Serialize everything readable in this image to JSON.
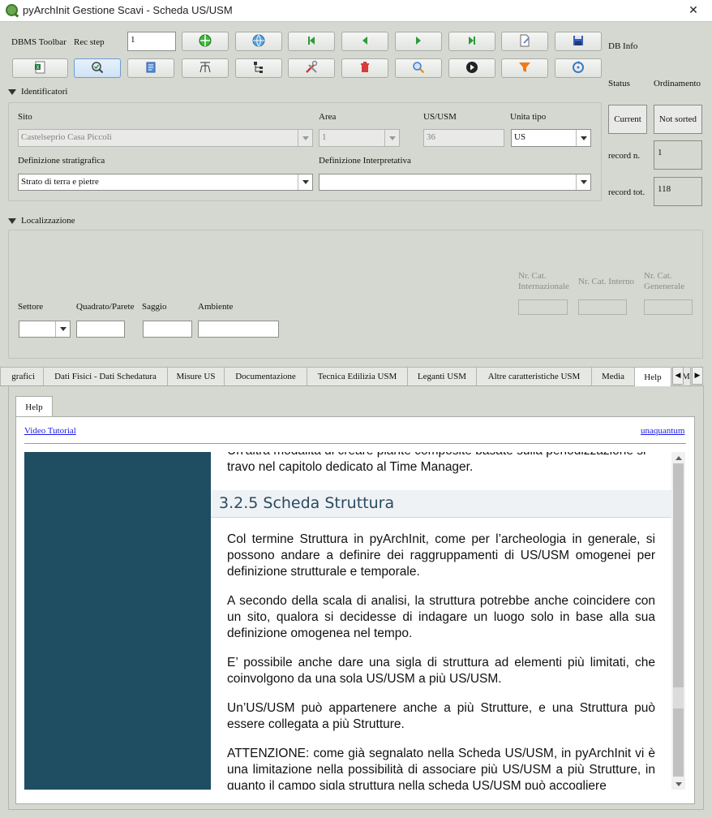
{
  "window": {
    "title": "pyArchInit Gestione Scavi - Scheda US/USM",
    "close": "✕"
  },
  "toolbar": {
    "dbms_label": "DBMS Toolbar",
    "rec_step_label": "Rec step",
    "rec_step_value": "1",
    "db_info_label": "DB Info",
    "row1_icons": [
      "connect-icon",
      "globe-icon",
      "first-record-icon",
      "prev-record-icon",
      "next-record-icon",
      "last-record-icon",
      "new-record-icon",
      "save-icon"
    ],
    "row2_icons": [
      "export-icon",
      "check-icon",
      "report-icon",
      "matrix-icon",
      "tree-icon",
      "tools-icon",
      "delete-icon",
      "search-icon",
      "play-icon",
      "filter-icon",
      "refresh-icon"
    ]
  },
  "status": {
    "status_label": "Status",
    "ordinamento_label": "Ordinamento",
    "current": "Current",
    "not_sorted": "Not sorted",
    "record_n_label": "record n.",
    "record_n": "1",
    "record_tot_label": "record tot.",
    "record_tot": "118"
  },
  "identificatori": {
    "header": "Identificatori",
    "sito_label": "Sito",
    "sito_value": "Castelseprio Casa Piccoli",
    "area_label": "Area",
    "area_value": "1",
    "us_label": "US/USM",
    "us_value": "36",
    "unita_tipo_label": "Unita tipo",
    "unita_tipo_value": "US",
    "def_strat_label": "Definizione stratigrafica",
    "def_strat_value": "Strato di terra e pietre",
    "def_interp_label": "Definizione Interpretativa",
    "def_interp_value": ""
  },
  "localizzazione": {
    "header": "Localizzazione",
    "settore_label": "Settore",
    "quadrato_label": "Quadrato/Parete",
    "saggio_label": "Saggio",
    "ambiente_label": "Ambiente",
    "nr_cat_int_label1": "Nr. Cat.",
    "nr_cat_int_label2": "Internazionale",
    "nr_cat_interno_label": "Nr. Cat. Interno",
    "nr_cat_gen_label1": "Nr. Cat.",
    "nr_cat_gen_label2": "Genenerale"
  },
  "tabs": [
    "grafici",
    "Dati Fisici - Dati Schedatura",
    "Misure US",
    "Documentazione",
    "Tecnica Edilizia USM",
    "Leganti USM",
    "Altre caratteristiche USM",
    "Media",
    "Help",
    "M"
  ],
  "tab_nav": {
    "left": "◀",
    "right": "▶"
  },
  "help": {
    "subtab": "Help",
    "video_tutorial": "Video Tutorial",
    "unaquantum": "unaquantum",
    "doc": {
      "partial_top": "Un'altra modalità di creare piante composite basate sulla periodizzazione si",
      "line2": "travo nel capitolo dedicato al Time Manager.",
      "heading": "3.2.5 Scheda Struttura",
      "p1": "Col termine Struttura in pyArchInit, come per l’archeologia in generale, si possono andare a definire dei raggruppamenti di US/USM omogenei per definizione strutturale e temporale.",
      "p2": "A secondo della scala di analisi, la struttura potrebbe anche coincidere con un sito, qualora si decidesse di indagare un luogo solo in base alla sua definizione omogenea nel tempo.",
      "p3": "E’ possibile anche dare una sigla di struttura ad elementi più limitati, che coinvolgono da una sola US/USM a più US/USM.",
      "p4": "Un’US/USM può appartenere anche a più Strutture, e una Struttura può essere collegata a più Strutture.",
      "p5": "ATTENZIONE: come già segnalato nella Scheda US/USM, in pyArchInit vi è una limitazione nella possibilità di associare più US/USM a più Strutture, in quanto il campo sigla struttura nella scheda US/USM può accogliere"
    }
  }
}
